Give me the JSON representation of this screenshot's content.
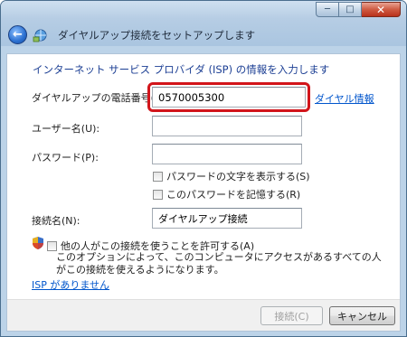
{
  "window": {
    "title": "ダイヤルアップ接続をセットアップします",
    "min_glyph": "─",
    "max_glyph": "□",
    "close_glyph": "✕"
  },
  "nav": {
    "back_glyph": "←"
  },
  "form": {
    "heading": "インターネット サービス プロバイダ (ISP) の情報を入力します",
    "phone_label": "ダイヤルアップの電話番号(D):",
    "phone_value": "0570005300",
    "dial_info_link": "ダイヤル情報",
    "username_label": "ユーザー名(U):",
    "username_value": "",
    "password_label": "パスワード(P):",
    "password_value": "",
    "show_chars_label": "パスワードの文字を表示する(S)",
    "remember_label": "このパスワードを記憶する(R)",
    "conn_name_label": "接続名(N):",
    "conn_name_value": "ダイヤルアップ接続",
    "allow_others_label": "他の人がこの接続を使うことを許可する(A)",
    "allow_others_desc": "このオプションによって、このコンピュータにアクセスがあるすべての人がこの接続を使えるようになります。",
    "no_isp_link": "ISP がありません"
  },
  "buttons": {
    "connect": "接続(C)",
    "cancel": "キャンセル"
  },
  "colors": {
    "highlight": "#d2151b",
    "heading": "#1c3f94",
    "link": "#0055cc"
  }
}
